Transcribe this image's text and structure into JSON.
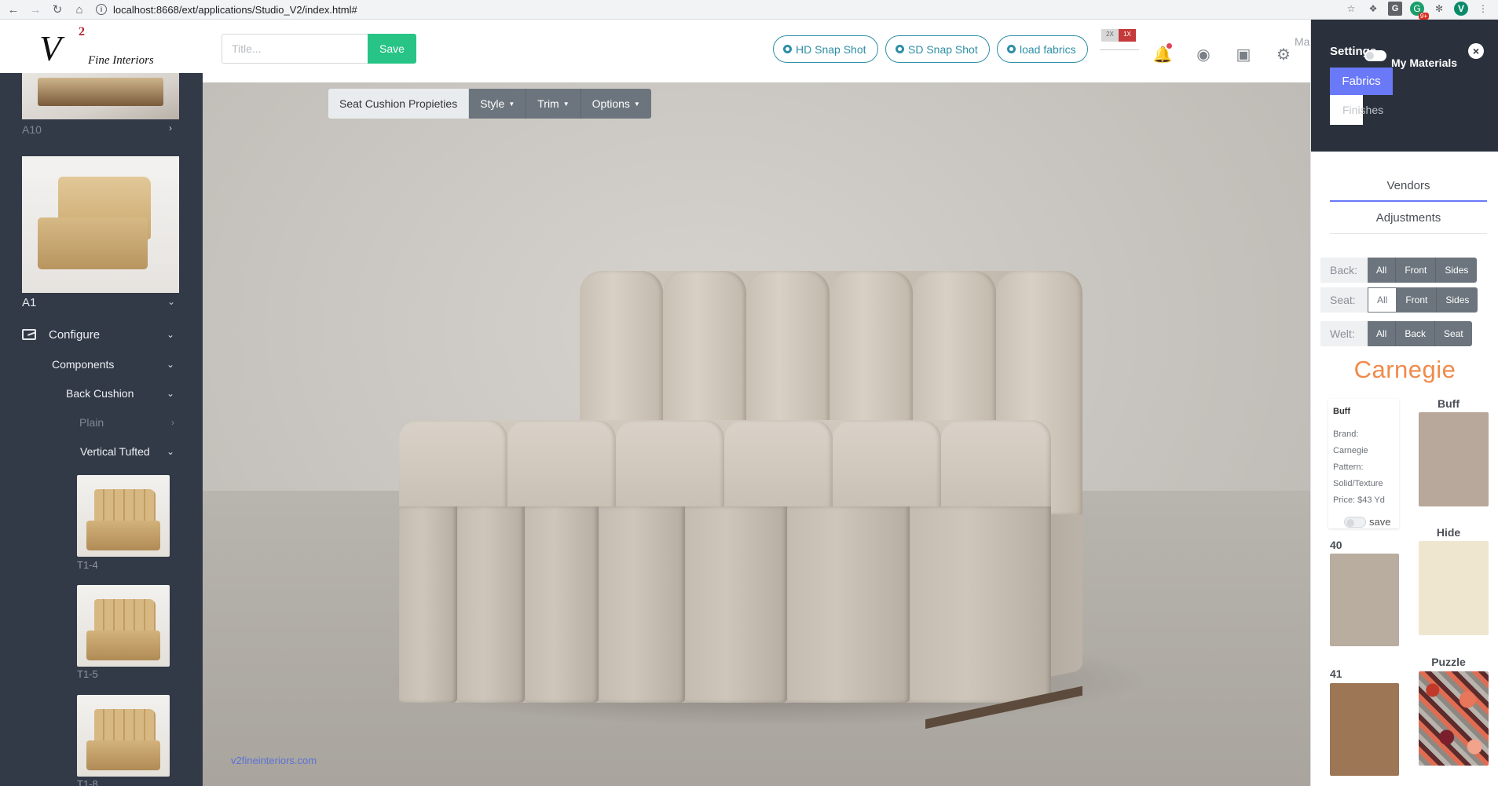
{
  "browser": {
    "url": "localhost:8668/ext/applications/Studio_V2/index.html#",
    "extension_badge": "9+",
    "avatar_initial": "V"
  },
  "logo": {
    "mark": "V",
    "superscript": "2",
    "tagline": "Fine Interiors"
  },
  "sidebar": {
    "items": [
      {
        "label": "A10"
      },
      {
        "label": "A1"
      }
    ],
    "configure_label": "Configure",
    "components_label": "Components",
    "back_cushion_label": "Back Cushion",
    "plain_label": "Plain",
    "vertical_tufted_label": "Vertical Tufted",
    "tiles": [
      {
        "label": "T1-4"
      },
      {
        "label": "T1-5"
      },
      {
        "label": "T1-8"
      }
    ]
  },
  "toolbar": {
    "title_placeholder": "Title...",
    "save_label": "Save",
    "hd_snap_label": "HD Snap Shot",
    "sd_snap_label": "SD Snap Shot",
    "load_fabrics_label": "load fabrics",
    "flag_a": "2X",
    "flag_b": "1X",
    "manage_label": "Ma"
  },
  "viewport": {
    "seat_cushion_label": "Seat Cushion Propieties",
    "style_label": "Style",
    "trim_label": "Trim",
    "options_label": "Options",
    "watermark": "v2fineinteriors.com"
  },
  "panel": {
    "title": "Settings",
    "my_materials_label": "My Materials",
    "fabrics_tab": "Fabrics",
    "finishes_tab": "Finishes",
    "vendors_label": "Vendors",
    "adjustments_label": "Adjustments",
    "back": {
      "label": "Back:",
      "opts": [
        "All",
        "Front",
        "Sides"
      ]
    },
    "seat": {
      "label": "Seat:",
      "opts": [
        "All",
        "Front",
        "Sides"
      ]
    },
    "welt": {
      "label": "Welt:",
      "opts": [
        "All",
        "Back",
        "Seat"
      ]
    },
    "vendor_name": "Carnegie",
    "selected": {
      "name": "Buff",
      "brand_label": "Brand:",
      "brand": "Carnegie",
      "pattern_label": "Pattern:",
      "pattern": "Solid/Texture",
      "price": "Price: $43 Yd",
      "save_label": "save"
    },
    "swatches": [
      {
        "name": "Buff",
        "color": "#b7a89b"
      },
      {
        "name": "40",
        "color": "#b9ada0"
      },
      {
        "name": "Hide",
        "color": "#efe6cf"
      },
      {
        "name": "41",
        "color": "#9c7655"
      },
      {
        "name": "Puzzle",
        "color": "#c4533f"
      }
    ]
  },
  "colors": {
    "sidebar_bg": "#323a48",
    "accent_green": "#27c485",
    "accent_blue": "#6979f8",
    "pill_teal": "#2e8fa5",
    "brand_orange": "#f08a4b"
  }
}
